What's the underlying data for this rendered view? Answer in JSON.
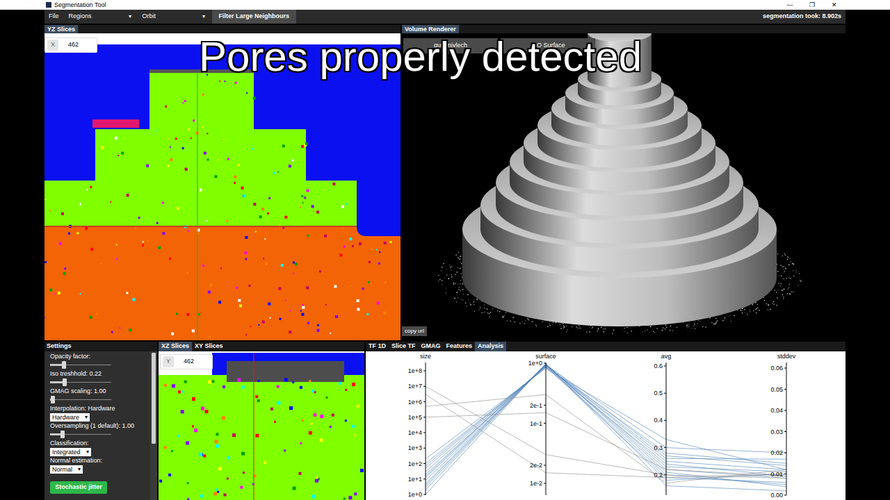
{
  "window": {
    "title": "Segmentation Tool",
    "controls": [
      "—",
      "❐",
      "✕"
    ]
  },
  "menu": [
    {
      "label": "File",
      "kind": "item"
    },
    {
      "label": "Regions",
      "kind": "dropdown",
      "arrow": "▾"
    },
    {
      "label": "Orbit",
      "kind": "dropdown",
      "arrow": "▾"
    },
    {
      "label": "Filter Large Neighbours",
      "kind": "button"
    }
  ],
  "status": "segmentation took: 8.902s",
  "caption": "Pores properly detected",
  "yz_panel": {
    "title": "YZ Slices",
    "axis_label": "X",
    "value": "462"
  },
  "volume_panel": {
    "title": "Volume Renderer",
    "buttons": [
      "gummivlech",
      "ISO Surface"
    ],
    "copy_button": "copy url"
  },
  "settings": {
    "title": "Settings",
    "items": [
      {
        "kind": "slider",
        "label": "Opacity factor:",
        "level": 0.23
      },
      {
        "kind": "slider",
        "label": "Iso treshhold: 0.22",
        "level": 0.24
      },
      {
        "kind": "slider",
        "label": "GMAG scaling: 1.00",
        "level": 0.05
      },
      {
        "kind": "select",
        "label": "Interpolation: Hardware",
        "value": "Hardware",
        "arrow": "▾"
      },
      {
        "kind": "slider",
        "label": "Oversampling (1 default): 1.00",
        "level": 0.21
      },
      {
        "kind": "select",
        "label": "Classification:",
        "value": "Integrated",
        "arrow": "▾"
      },
      {
        "kind": "select",
        "label": "Normal estimation:",
        "value": "Normal",
        "arrow": "▾"
      }
    ],
    "button": "Stochastic jitter",
    "scrollbar": {
      "level": 0.62
    }
  },
  "slice_panel": {
    "tabs": [
      {
        "label": "XZ Slices",
        "selected": true
      },
      {
        "label": "XY Slices",
        "selected": false
      }
    ],
    "axis_label": "Y",
    "value": "462"
  },
  "analysis_panel": {
    "tabs": [
      {
        "label": "TF 1D",
        "selected": false
      },
      {
        "label": "Slice TF",
        "selected": false
      },
      {
        "label": "GMAG",
        "selected": false
      },
      {
        "label": "Features",
        "selected": false
      },
      {
        "label": "Analysis",
        "selected": true
      }
    ],
    "chart": {
      "axes": [
        {
          "label": "size",
          "kind": "log",
          "ticks": [
            {
              "label": "1e+8",
              "value": 100000000
            },
            {
              "label": "1e+7",
              "value": 10000000
            },
            {
              "label": "1e+6",
              "value": 1000000
            },
            {
              "label": "1e+5",
              "value": 100000
            },
            {
              "label": "1e+4",
              "value": 10000
            },
            {
              "label": "1e+3",
              "value": 1000
            },
            {
              "label": "1e+2",
              "value": 100
            },
            {
              "label": "1e+1",
              "value": 10
            },
            {
              "label": "1e+0",
              "value": 1
            }
          ]
        },
        {
          "label": "surface",
          "kind": "log",
          "ticks": [
            {
              "label": "1e+0",
              "value": 1
            },
            {
              "label": "2e-1",
              "value": 0.2
            },
            {
              "label": "1e-1",
              "value": 0.1
            },
            {
              "label": "2e-2",
              "value": 0.02
            },
            {
              "label": "1e-2",
              "value": 0.01
            }
          ]
        },
        {
          "label": "avg",
          "kind": "linear",
          "ticks": [
            {
              "label": "0.6",
              "value": 0.6
            },
            {
              "label": "0.5",
              "value": 0.5
            },
            {
              "label": "0.4",
              "value": 0.4
            },
            {
              "label": "0.3",
              "value": 0.3
            },
            {
              "label": "0.2",
              "value": 0.2
            }
          ]
        },
        {
          "label": "stddev",
          "kind": "linear",
          "ticks": [
            {
              "label": "0.06",
              "value": 0.06
            },
            {
              "label": "0.05",
              "value": 0.05
            },
            {
              "label": "0.04",
              "value": 0.04
            },
            {
              "label": "0.03",
              "value": 0.03
            },
            {
              "label": "0.02",
              "value": 0.02
            },
            {
              "label": "0.01",
              "value": 0.01
            },
            {
              "label": "0.00",
              "value": 0
            }
          ]
        }
      ],
      "series": [
        {
          "values": [
            3,
            0.95,
            0.22,
            0.008
          ],
          "color": "#4a7fb5"
        },
        {
          "values": [
            8,
            0.92,
            0.25,
            0.012
          ],
          "color": "#4a7fb5"
        },
        {
          "values": [
            20,
            0.9,
            0.2,
            0.005
          ],
          "color": "#4a7fb5"
        },
        {
          "values": [
            50,
            0.88,
            0.28,
            0.015
          ],
          "color": "#4a7fb5"
        },
        {
          "values": [
            2,
            0.97,
            0.18,
            0.01
          ],
          "color": "#4a7fb5"
        },
        {
          "values": [
            12,
            0.93,
            0.3,
            0.02
          ],
          "color": "#4a7fb5"
        },
        {
          "values": [
            100,
            0.85,
            0.24,
            0.009
          ],
          "color": "#4a7fb5"
        },
        {
          "values": [
            5,
            0.96,
            0.21,
            0.004
          ],
          "color": "#4a7fb5"
        },
        {
          "values": [
            30,
            0.91,
            0.26,
            0.017
          ],
          "color": "#4a7fb5"
        },
        {
          "values": [
            1,
            0.99,
            0.16,
            0.002
          ],
          "color": "#4a7fb5"
        },
        {
          "values": [
            200,
            0.82,
            0.33,
            0.012
          ],
          "color": "#4a7fb5"
        },
        {
          "values": [
            15,
            0.94,
            0.23,
            0.011
          ],
          "color": "#4a7fb5"
        },
        {
          "values": [
            70,
            0.87,
            0.19,
            0.006
          ],
          "color": "#4a7fb5"
        },
        {
          "values": [
            4,
            0.95,
            0.27,
            0.014
          ],
          "color": "#4a7fb5"
        },
        {
          "values": [
            10000000,
            0.03,
            0.2,
            0.008
          ],
          "color": "#8a8a8a"
        },
        {
          "values": [
            3000000,
            0.015,
            0.19,
            0.01
          ],
          "color": "#8a8a8a"
        },
        {
          "values": [
            500000,
            0.3,
            0.17,
            0.012
          ],
          "color": "#8a8a8a"
        },
        {
          "values": [
            100000,
            0.15,
            0.22,
            0.009
          ],
          "color": "#8a8a8a"
        }
      ]
    }
  }
}
